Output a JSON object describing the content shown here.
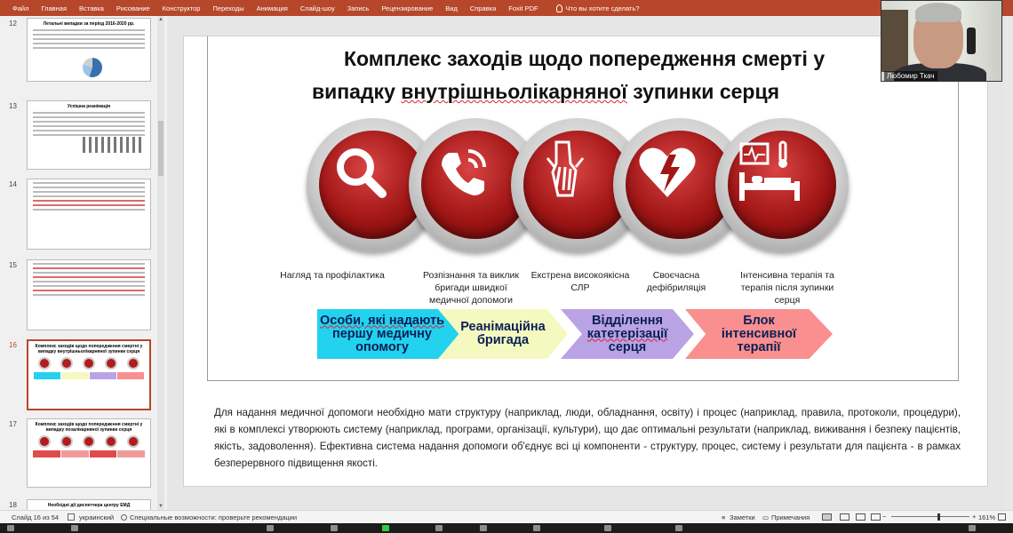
{
  "menu": {
    "items": [
      "Файл",
      "Главная",
      "Вставка",
      "Рисование",
      "Конструктор",
      "Переходы",
      "Анимация",
      "Слайд-шоу",
      "Запись",
      "Рецензирование",
      "Вид",
      "Справка",
      "Foxit PDF"
    ],
    "tell_me": "Что вы хотите сделать?"
  },
  "thumbnails": [
    {
      "num": "12",
      "title": "Летальні випадки за період 2016-2020 рр."
    },
    {
      "num": "13",
      "title": "Успішна реанімація"
    },
    {
      "num": "14",
      "title": ""
    },
    {
      "num": "15",
      "title": ""
    },
    {
      "num": "16",
      "title": "Комплекс заходів щодо попередження смертні у випадку внутрішньолікарняної зупинки серця"
    },
    {
      "num": "17",
      "title": "Комплекс заходів щодо попередження смертні у випадку позалікарняної зупинки серця"
    },
    {
      "num": "18",
      "title": "Необхідні дії диспетчера центру ЕМД"
    }
  ],
  "slide": {
    "title_line1": "Комплекс заходів щодо попередження смерті у",
    "title_line2_pre": "випадку ",
    "title_line2_squig": "внутрішньолікарняної",
    "title_line2_post": " зупинки серця",
    "icons": [
      "magnifier-icon",
      "phone-icon",
      "cpr-hands-icon",
      "defibrillator-heart-icon",
      "icu-bed-monitor-icon"
    ],
    "captions": [
      [
        "Нагляд та профілактика"
      ],
      [
        "Розпізнання та виклик",
        "бригади швидкої",
        "медичної допомоги"
      ],
      [
        "Екстрена високоякісна",
        "СЛР"
      ],
      [
        "Своєчасна",
        "дефібриляція"
      ],
      [
        "Інтенсивна терапія та",
        "терапія після зупинки",
        "серця"
      ]
    ],
    "arrows": [
      {
        "lines": [
          "Особи, які надають",
          "першу медичну",
          "опомогу"
        ],
        "color": "#22d2ee"
      },
      {
        "lines": [
          "Реанімаційна",
          "бригада"
        ],
        "color": "#f4f9c0"
      },
      {
        "lines": [
          "Відділення",
          "катетерізації",
          "серця"
        ],
        "color": "#b9a3e4"
      },
      {
        "lines": [
          "Блок",
          "інтенсивної",
          "терапії"
        ],
        "color": "#f98f8f"
      }
    ]
  },
  "notes": "Для надання медичної допомоги необхідно мати структуру (наприклад, люди, обладнання, освіту) і процес (наприклад, правила, протоколи, процедури), які в комплексі утворюють систему (наприклад, програми, організації, культури), що дає оптимальні результати (наприклад, виживання і безпеку пацієнтів, якість, задоволення). Ефективна система надання допомоги об'єднує всі ці компоненти - структуру, процес, систему і результати для пацієнта - в рамках безперервного підвищення якості.",
  "webcam": {
    "name": "Любомир Ткач"
  },
  "status": {
    "slide_info": "Слайд 16 из 54",
    "language": "украинский",
    "accessibility": "Специальные возможности: проверьте рекомендации",
    "notes_label": "Заметки",
    "comments_label": "Примечания",
    "zoom": "161%"
  },
  "colors": {
    "ribbon": "#b7472a",
    "icon_red": "#a11616",
    "active_thumb_border": "#b7472a"
  }
}
